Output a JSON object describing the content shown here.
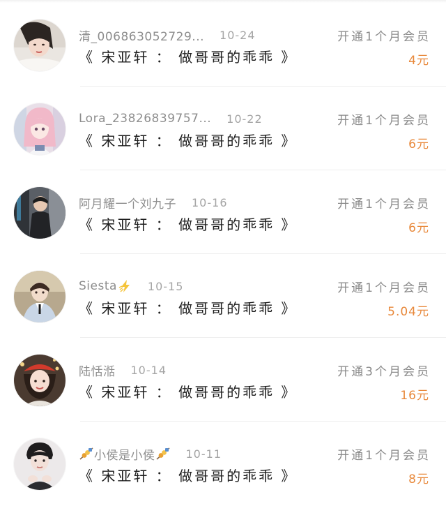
{
  "accent_color": "#e8883a",
  "rows": [
    {
      "username": "清_006863052729...",
      "date": "10-24",
      "work_title": "《 宋亚轩 ： 做哥哥的乖乖 》",
      "vip_info": "开通1个月会员",
      "amount": "4元",
      "avatar": "avatar-girl-lying"
    },
    {
      "username": "Lora_23826839757...",
      "date": "10-22",
      "work_title": "《 宋亚轩 ： 做哥哥的乖乖 》",
      "vip_info": "开通1个月会员",
      "amount": "6元",
      "avatar": "avatar-anime-pink-hair"
    },
    {
      "username": "阿月耀一个刘九子",
      "date": "10-16",
      "work_title": "《 宋亚轩 ： 做哥哥的乖乖 》",
      "vip_info": "开通1个月会员",
      "amount": "6元",
      "avatar": "avatar-boy-street"
    },
    {
      "username": "Siesta",
      "date": "10-15",
      "work_title": "《 宋亚轩 ： 做哥哥的乖乖 》",
      "vip_info": "开通1个月会员",
      "amount": "5.04元",
      "avatar": "avatar-boy-suit"
    },
    {
      "username": "陆恬湉",
      "date": "10-14",
      "work_title": "《 宋亚轩 ： 做哥哥的乖乖 》",
      "vip_info": "开通3个月会员",
      "amount": "16元",
      "avatar": "avatar-girl-red-beret"
    },
    {
      "username": "小侯是小侯",
      "date": "10-11",
      "work_title": "《 宋亚轩 ： 做哥哥的乖乖 》",
      "vip_info": "开通1个月会员",
      "amount": "8元",
      "avatar": "avatar-person-hands"
    }
  ]
}
